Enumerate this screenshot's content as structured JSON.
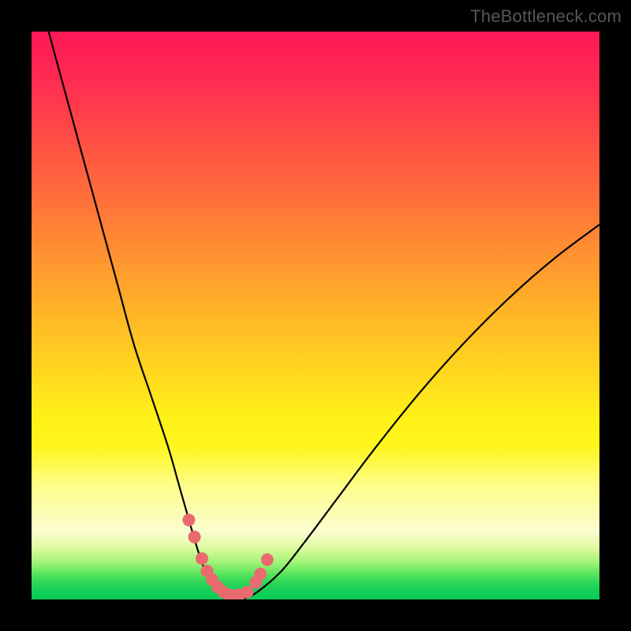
{
  "watermark": "TheBottleneck.com",
  "chart_data": {
    "type": "line",
    "title": "",
    "xlabel": "",
    "ylabel": "",
    "xlim": [
      0,
      100
    ],
    "ylim": [
      0,
      100
    ],
    "series": [
      {
        "name": "bottleneck-curve",
        "x": [
          3,
          6,
          9,
          12,
          15,
          18,
          21,
          24,
          26,
          28,
          29.5,
          31,
          33,
          35,
          37.5,
          40,
          44,
          48,
          54,
          60,
          68,
          76,
          84,
          92,
          100
        ],
        "y": [
          100,
          89,
          78,
          67,
          56,
          45,
          36,
          27,
          20,
          13,
          8,
          4,
          1,
          0,
          0.2,
          1.5,
          5,
          10,
          18,
          26,
          36,
          45,
          53,
          60,
          66
        ]
      }
    ],
    "markers": {
      "name": "highlight-dots",
      "x": [
        27.7,
        28.7,
        30.0,
        30.9,
        31.8,
        32.8,
        33.8,
        34.8,
        35.8,
        36.6,
        38.0,
        39.5,
        40.3,
        41.5
      ],
      "y": [
        14.0,
        11.0,
        7.2,
        5.0,
        3.5,
        2.2,
        1.3,
        0.8,
        0.7,
        0.8,
        1.3,
        3.0,
        4.5,
        7.0
      ],
      "color": "#e96a6f",
      "size": 8
    },
    "gradient_stops": [
      {
        "pos": 0.0,
        "color": "#ff1856"
      },
      {
        "pos": 0.5,
        "color": "#ffc024"
      },
      {
        "pos": 0.8,
        "color": "#fdfd8a"
      },
      {
        "pos": 1.0,
        "color": "#08cc58"
      }
    ]
  }
}
